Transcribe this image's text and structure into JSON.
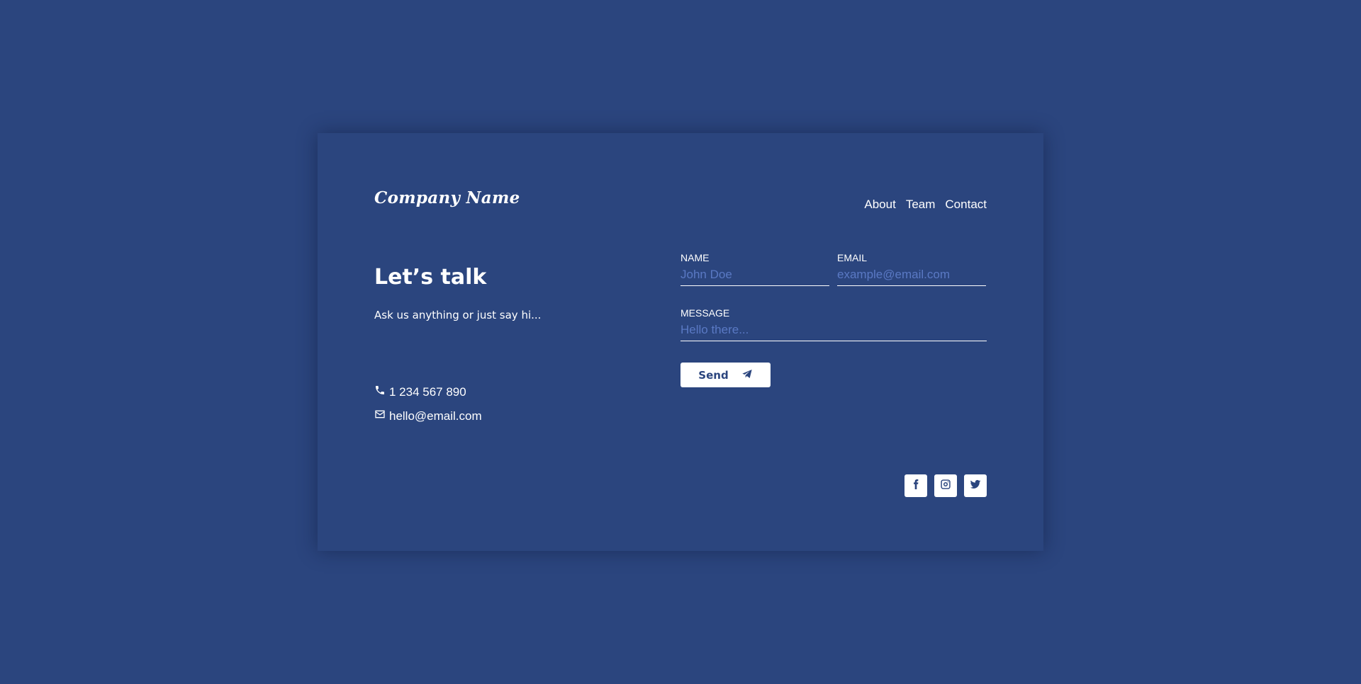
{
  "header": {
    "brand": "Company Name",
    "nav": [
      {
        "label": "About"
      },
      {
        "label": "Team"
      },
      {
        "label": "Contact"
      }
    ]
  },
  "intro": {
    "title": "Let’s talk",
    "subtitle": "Ask us anything or just say hi..."
  },
  "contact": {
    "phone": "1 234 567 890",
    "email": "hello@email.com"
  },
  "form": {
    "name": {
      "label": "NAME",
      "placeholder": "John Doe",
      "value": ""
    },
    "email": {
      "label": "EMAIL",
      "placeholder": "example@email.com",
      "value": ""
    },
    "message": {
      "label": "MESSAGE",
      "placeholder": "Hello there...",
      "value": ""
    },
    "send_label": "Send"
  },
  "socials": [
    {
      "icon": "facebook-icon"
    },
    {
      "icon": "instagram-icon"
    },
    {
      "icon": "twitter-icon"
    }
  ],
  "colors": {
    "background": "#2b457e",
    "text": "#ffffff",
    "placeholder": "#5a79c4"
  }
}
